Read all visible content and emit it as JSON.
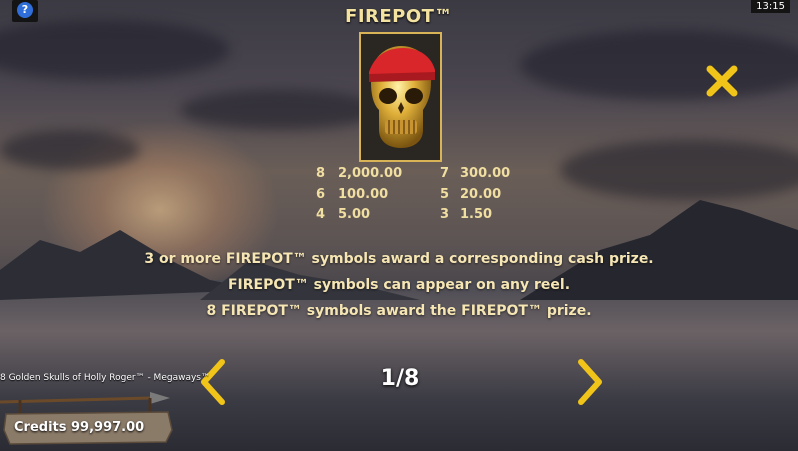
{
  "header": {
    "help_icon_glyph": "?",
    "clock": "13:15",
    "title": "FIREPOT™"
  },
  "symbol": {
    "icon": "golden-skull-red-bandana-icon",
    "frame_color": "#d8b457"
  },
  "paytable": [
    [
      {
        "count": "8",
        "value": "2,000.00"
      },
      {
        "count": "7",
        "value": "300.00"
      }
    ],
    [
      {
        "count": "6",
        "value": "100.00"
      },
      {
        "count": "5",
        "value": "20.00"
      }
    ],
    [
      {
        "count": "4",
        "value": "5.00"
      },
      {
        "count": "3",
        "value": "1.50"
      }
    ]
  ],
  "description": [
    "3 or more FIREPOT™ symbols award a corresponding cash prize.",
    "FIREPOT™ symbols can appear on any reel.",
    "8 FIREPOT™ symbols award the FIREPOT™ prize."
  ],
  "navigation": {
    "page_indicator": "1/8",
    "prev_icon": "chevron-left-icon",
    "next_icon": "chevron-right-icon"
  },
  "footer": {
    "game_title": "8 Golden Skulls of Holly Roger™ - Megaways™",
    "credits_label": "Credits 99,997.00"
  },
  "colors": {
    "gold": "#f0c419",
    "text_gold": "#f1dfa2",
    "help_blue": "#2f6ed8"
  }
}
